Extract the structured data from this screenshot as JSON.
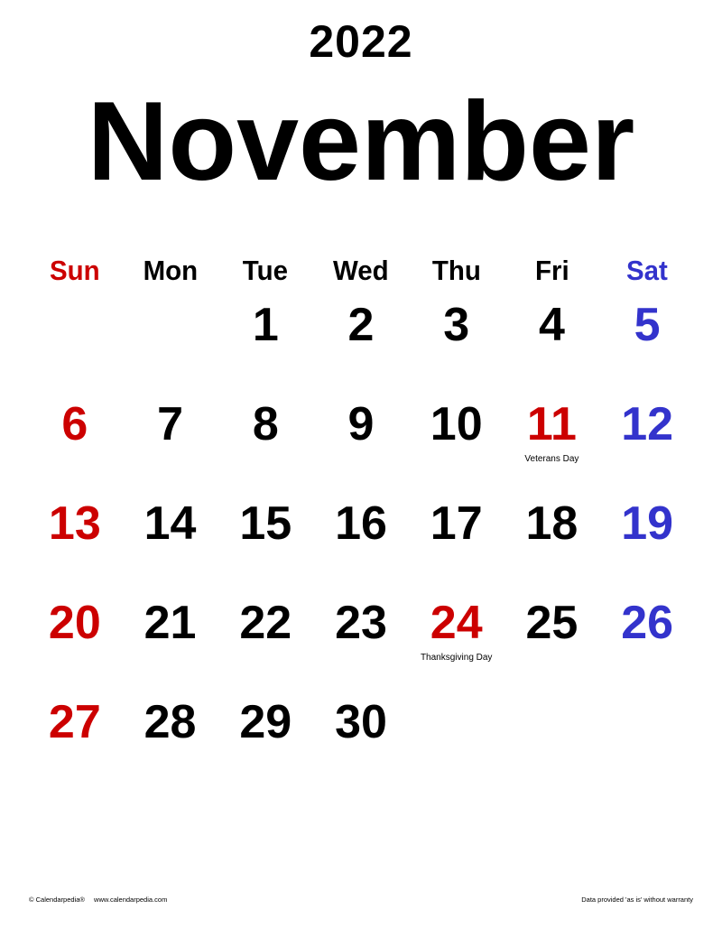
{
  "calendar": {
    "year": "2022",
    "month": "November",
    "weekdays": [
      {
        "label": "Sun",
        "type": "sunday"
      },
      {
        "label": "Mon",
        "type": "weekday"
      },
      {
        "label": "Tue",
        "type": "weekday"
      },
      {
        "label": "Wed",
        "type": "weekday"
      },
      {
        "label": "Thu",
        "type": "weekday"
      },
      {
        "label": "Fri",
        "type": "weekday"
      },
      {
        "label": "Sat",
        "type": "saturday"
      }
    ],
    "first_weekday_index": 2,
    "days_in_month": 30,
    "holidays": [
      {
        "day": 11,
        "name": "Veterans Day"
      },
      {
        "day": 24,
        "name": "Thanksgiving Day"
      }
    ],
    "colors": {
      "sunday": "#cc0000",
      "holiday": "#cc0000",
      "saturday": "#3333cc",
      "default": "#000000"
    }
  },
  "footer": {
    "copyright": "© Calendarpedia®",
    "website": "www.calendarpedia.com",
    "disclaimer": "Data provided 'as is' without warranty"
  }
}
